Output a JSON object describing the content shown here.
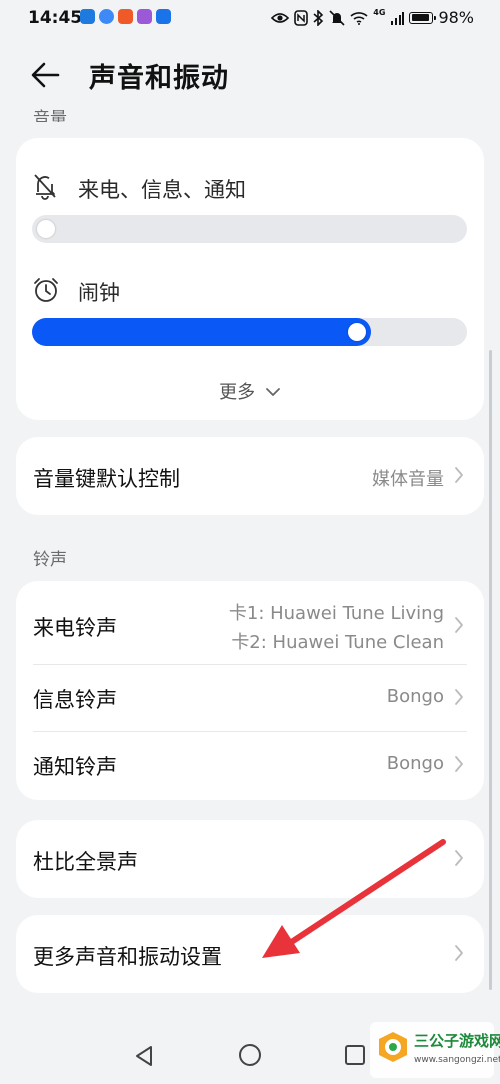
{
  "status_bar": {
    "time": "14:45",
    "battery_text": "98%",
    "battery_level": 0.98,
    "network_badge": "4G",
    "app_icon_colors": [
      "#1f7ae0",
      "#3d8af7",
      "#f05a28",
      "#9b59d8",
      "#1a73e8"
    ]
  },
  "header": {
    "title": "声音和振动",
    "back_icon": "arrow-left-icon"
  },
  "volume_section": {
    "label": "音量",
    "rows": [
      {
        "label": "来电、信息、通知",
        "icon": "bell-off-icon",
        "level": 0.0
      },
      {
        "label": "闹钟",
        "icon": "alarm-clock-icon",
        "level": 0.78
      }
    ],
    "more_label": "更多"
  },
  "volume_key_row": {
    "label": "音量键默认控制",
    "value": "媒体音量"
  },
  "ringtone_section": {
    "label": "铃声",
    "rows": [
      {
        "label": "来电铃声",
        "value_line1": "卡1: Huawei Tune Living",
        "value_line2": "卡2: Huawei Tune Clean"
      },
      {
        "label": "信息铃声",
        "value": "Bongo"
      },
      {
        "label": "通知铃声",
        "value": "Bongo"
      }
    ]
  },
  "dolby_row": {
    "label": "杜比全景声"
  },
  "more_settings_row": {
    "label": "更多声音和振动设置"
  },
  "watermark": {
    "title": "三公子游戏网",
    "url": "www.sangongzi.net"
  },
  "colors": {
    "accent": "#0a59f7",
    "annotation_arrow": "#e8333a",
    "background": "#f1f3f5",
    "card": "#ffffff"
  }
}
